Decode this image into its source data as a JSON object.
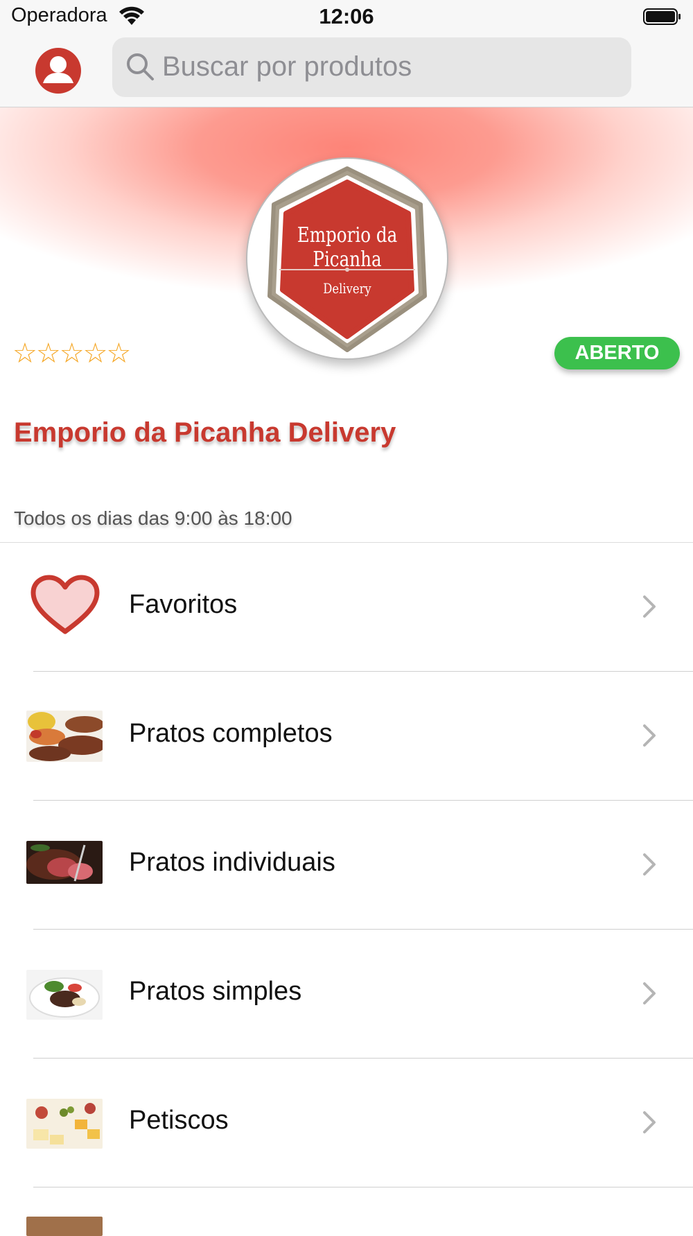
{
  "status_bar": {
    "carrier": "Operadora",
    "time": "12:06"
  },
  "search": {
    "placeholder": "Buscar por produtos"
  },
  "store": {
    "logo_title": "Emporio da Picanha",
    "logo_subtitle": "Delivery",
    "rating_stars": "☆☆☆☆☆",
    "status": "ABERTO",
    "name": "Emporio da Picanha Delivery",
    "hours": "Todos os dias das 9:00 às 18:00"
  },
  "menu": [
    {
      "label": "Favoritos",
      "icon": "heart-icon"
    },
    {
      "label": "Pratos completos",
      "icon": "food-thumb"
    },
    {
      "label": "Pratos individuais",
      "icon": "food-thumb"
    },
    {
      "label": "Pratos simples",
      "icon": "food-thumb"
    },
    {
      "label": "Petiscos",
      "icon": "food-thumb"
    }
  ],
  "colors": {
    "accent": "#c8392f",
    "open_badge": "#3cc04d",
    "hero": "#fd8478"
  }
}
